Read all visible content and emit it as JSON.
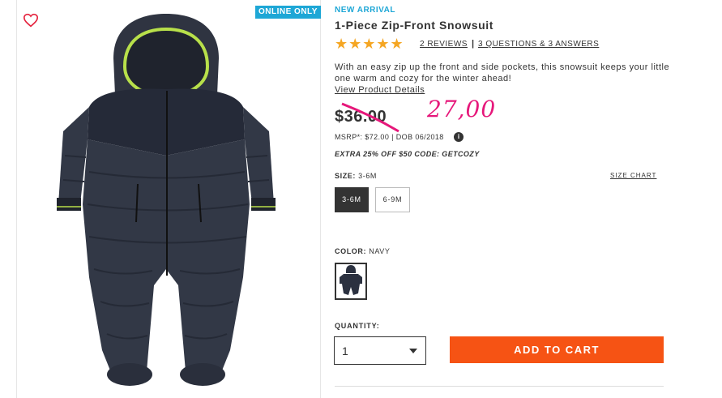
{
  "badge": "ONLINE ONLY",
  "product": {
    "tag": "NEW ARRIVAL",
    "title": "1-Piece Zip-Front Snowsuit",
    "rating": 5,
    "stars": "★★★★★",
    "reviews_link": "2 REVIEWS",
    "separator": "|",
    "qa_link": "3 QUESTIONS & 3 ANSWERS",
    "description": "With an easy zip up the front and side pockets, this snowsuit keeps your little one warm and cozy for the winter ahead!",
    "details_link": "View Product Details"
  },
  "price": {
    "current": "$36.00",
    "handwritten_note": "27,00",
    "msrp_line": "MSRP*: $72.00 | DOB 06/2018",
    "info_glyph": "i",
    "promo": "EXTRA 25% OFF $50 CODE: GETCOZY"
  },
  "size": {
    "label": "SIZE:",
    "selected_value": "3-6M",
    "chart_link": "SIZE CHART",
    "options": [
      "3-6M",
      "6-9M"
    ]
  },
  "color": {
    "label": "COLOR:",
    "selected_value": "NAVY",
    "swatch_color": "#2b3140"
  },
  "quantity": {
    "label": "QUANTITY:",
    "value": "1"
  },
  "cta": {
    "label": "ADD TO CART",
    "color": "#f65314"
  },
  "colors": {
    "accent_blue": "#1ea7d6",
    "star": "#f5a623",
    "handwriting": "#e6177a",
    "suit_body": "#2f3441",
    "hood_trim": "#b8e04a"
  },
  "icons": {
    "favorite": "heart-outline-icon",
    "info": "info-icon",
    "dropdown": "chevron-down-icon"
  }
}
